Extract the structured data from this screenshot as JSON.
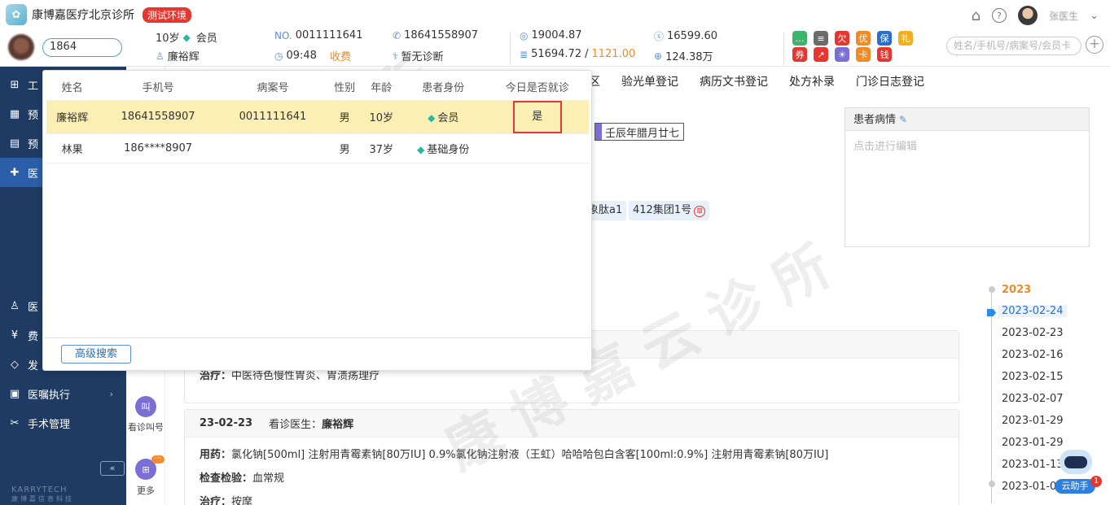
{
  "header": {
    "logo_glyph": "✿",
    "clinic_name": "康博嘉医疗北京诊所",
    "env_badge": "测试环境",
    "home_glyph": "⌂",
    "help_glyph": "?",
    "user_name": "张医生",
    "user_caret": "⌄"
  },
  "patient": {
    "search_value": "1864",
    "age": "10岁",
    "membership": "会员",
    "name": "廉裕辉",
    "no_prefix": "NO.",
    "record_no": "0011111641",
    "time": "09:48",
    "charge_status": "收费",
    "phone": "18641558907",
    "diagnosis": "暂无诊断",
    "balance_1": "19004.87",
    "balance_2_a": "51694.72",
    "balance_sep": "/",
    "balance_2_b": "1121.00",
    "points": "16599.60",
    "total": "124.38万"
  },
  "toolbar_icons": [
    {
      "name": "chat-icon",
      "glyph": "…",
      "color": "#3fb26b"
    },
    {
      "name": "list-icon",
      "glyph": "≡",
      "color": "#6b6b6b"
    },
    {
      "name": "owe-icon",
      "glyph": "欠",
      "color": "#e5362f"
    },
    {
      "name": "discount-icon",
      "glyph": "优",
      "color": "#f08a24"
    },
    {
      "name": "insurance-icon",
      "glyph": "保",
      "color": "#2a6fc9"
    },
    {
      "name": "gift-icon",
      "glyph": "礼",
      "color": "#f0b020"
    },
    {
      "name": "ticket-icon",
      "glyph": "券",
      "color": "#e5362f"
    },
    {
      "name": "chart-icon",
      "glyph": "↗",
      "color": "#e5362f"
    },
    {
      "name": "idea-icon",
      "glyph": "☀",
      "color": "#7b6fd6"
    },
    {
      "name": "card-icon",
      "glyph": "卡",
      "color": "#f08a24"
    },
    {
      "name": "wallet-icon",
      "glyph": "钱",
      "color": "#e5362f"
    }
  ],
  "global_search_placeholder": "姓名/手机号/病案号/会员卡",
  "plus_glyph": "+",
  "sidebar": {
    "items": [
      {
        "label": "工",
        "icon": "⊞"
      },
      {
        "label": "预",
        "icon": "▦"
      },
      {
        "label": "预",
        "icon": "▤"
      },
      {
        "label": "医",
        "icon": "✚"
      },
      {
        "label": "医",
        "icon": "♙"
      },
      {
        "label": "费",
        "icon": "¥"
      },
      {
        "label": "发",
        "icon": "◇"
      },
      {
        "label": "医嘱执行",
        "icon": "▣",
        "arrow": "›"
      },
      {
        "label": "手术管理",
        "icon": "✂"
      }
    ],
    "collapse_glyph": "«",
    "brand": "KARRYTECH",
    "brand_sub": "康博嘉信息科技"
  },
  "quickbar": {
    "call_glyph": "叫",
    "call_label": "看诊叫号",
    "more_glyph": "⊞",
    "more_label": "更多",
    "more_badge": "···"
  },
  "tabs": [
    "区",
    "验光单登记",
    "病历文书登记",
    "处方补录",
    "门诊日志登记"
  ],
  "lunar_date": "壬辰年腊月廿七",
  "chips": [
    {
      "label": "象肽a1"
    },
    {
      "label": "412集团1号",
      "seal": "章"
    }
  ],
  "condition": {
    "title": "患者病情",
    "edit_glyph": "✎",
    "placeholder": "点击进行编辑"
  },
  "records": [
    {
      "lines": [
        {
          "label": "治疗：",
          "text": "中医待色慢性胃炎、胃溃疡理疗"
        }
      ]
    },
    {
      "date": "23-02-23",
      "doctor_label": "看诊医生：",
      "doctor": "廉裕辉",
      "lines": [
        {
          "label": "用药：",
          "text": "氯化钠[500ml]   注射用青霉素钠[80万IU]   0.9%氯化钠注射液（王虹）哈哈哈包白含客[100ml:0.9%]   注射用青霉素钠[80万IU]"
        },
        {
          "label": "检查检验：",
          "text": "血常规"
        },
        {
          "label": "治疗：",
          "text": "按摩"
        }
      ]
    }
  ],
  "timeline": {
    "year": "2023",
    "dates": [
      "2023-02-24",
      "2023-02-23",
      "2023-02-16",
      "2023-02-15",
      "2023-02-07",
      "2023-01-29",
      "2023-01-29",
      "2023-01-13",
      "2023-01-04"
    ]
  },
  "assistant": {
    "label": "云助手",
    "badge": "1"
  },
  "watermark": "康博嘉云诊所",
  "popup": {
    "columns": [
      "姓名",
      "手机号",
      "病案号",
      "性别",
      "年龄",
      "患者身份",
      "今日是否就诊"
    ],
    "rows": [
      {
        "name": "廉裕辉",
        "phone": "18641558907",
        "record": "0011111641",
        "gender": "男",
        "age": "10岁",
        "identity": "会员",
        "visited": "是"
      },
      {
        "name": "林果",
        "phone": "186****8907",
        "record": "",
        "gender": "男",
        "age": "37岁",
        "identity": "基础身份",
        "visited": ""
      }
    ],
    "advanced_search": "高级搜索"
  }
}
